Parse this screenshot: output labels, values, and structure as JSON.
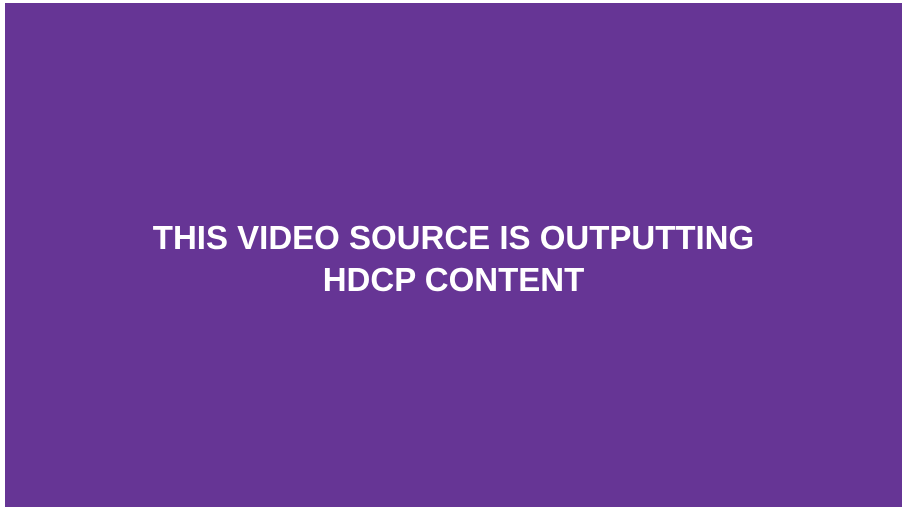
{
  "colors": {
    "background": "#663595",
    "text": "#ffffff",
    "border": "#ffffff"
  },
  "message": {
    "line1": "THIS VIDEO SOURCE IS OUTPUTTING",
    "line2": "HDCP CONTENT"
  }
}
